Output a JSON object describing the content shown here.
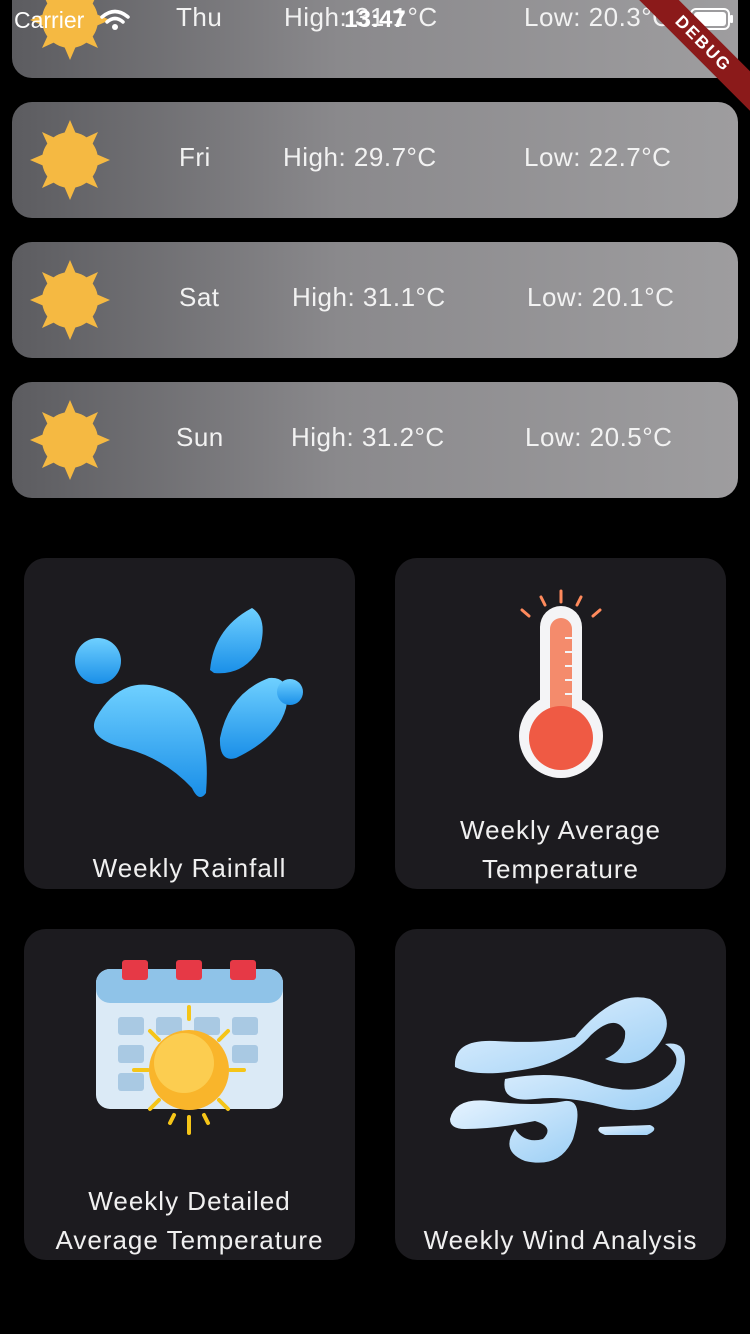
{
  "status_bar": {
    "carrier": "Carrier",
    "time": "13:47",
    "debug_label": "DEBUG"
  },
  "forecast": [
    {
      "day": "Thu",
      "high": "High: 31.1°C",
      "low": "Low: 20.3°C",
      "icon": "sun-icon"
    },
    {
      "day": "Fri",
      "high": "High: 29.7°C",
      "low": "Low: 22.7°C",
      "icon": "sun-icon"
    },
    {
      "day": "Sat",
      "high": "High: 31.1°C",
      "low": "Low: 20.1°C",
      "icon": "sun-icon"
    },
    {
      "day": "Sun",
      "high": "High: 31.2°C",
      "low": "Low: 20.5°C",
      "icon": "sun-icon"
    }
  ],
  "tiles": {
    "rainfall": {
      "label": "Weekly Rainfall",
      "icon": "water-drops-icon"
    },
    "avg_temp": {
      "label_line1": "Weekly Average",
      "label_line2": "Temperature",
      "icon": "thermometer-icon"
    },
    "detailed_temp": {
      "label_line1": "Weekly Detailed",
      "label_line2": "Average Temperature",
      "icon": "calendar-sun-icon"
    },
    "wind": {
      "label": "Weekly Wind Analysis",
      "icon": "wind-icon"
    }
  },
  "colors": {
    "background": "#000000",
    "card_gradient_start": "#5c5c60",
    "card_gradient_end": "#9e9d9f",
    "tile_background": "#1c1b1f",
    "sun": "#f5b942",
    "debug_ribbon": "#8b1a1a"
  }
}
